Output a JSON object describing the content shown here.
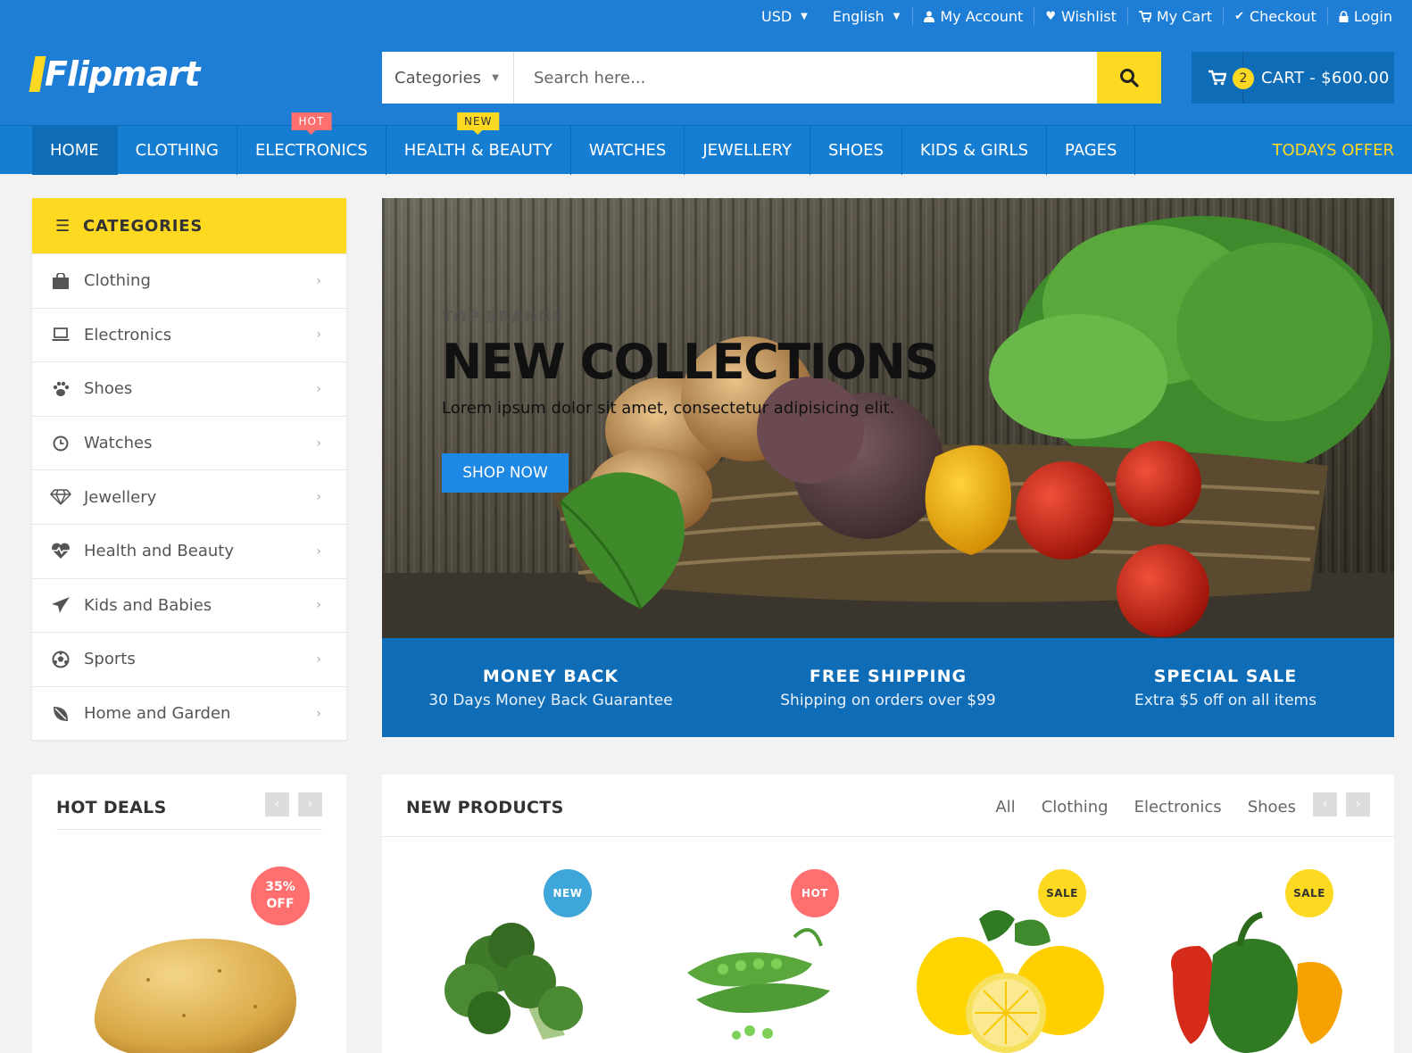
{
  "header": {
    "top_links": {
      "currency": "USD",
      "language": "English",
      "account": "My Account",
      "wishlist": "Wishlist",
      "cart": "My Cart",
      "checkout": "Checkout",
      "login": "Login"
    },
    "logo": "Flipmart",
    "search": {
      "category": "Categories",
      "placeholder": "Search here..."
    },
    "cart": {
      "count": "2",
      "label": "CART - $600.00"
    }
  },
  "nav": {
    "items": [
      {
        "label": "HOME"
      },
      {
        "label": "CLOTHING"
      },
      {
        "label": "ELECTRONICS",
        "tag": "HOT"
      },
      {
        "label": "HEALTH & BEAUTY",
        "tag": "NEW"
      },
      {
        "label": "WATCHES"
      },
      {
        "label": "JEWELLERY"
      },
      {
        "label": "SHOES"
      },
      {
        "label": "KIDS & GIRLS"
      },
      {
        "label": "PAGES"
      }
    ],
    "offer": "TODAYS OFFER"
  },
  "sidebar": {
    "title": "CATEGORIES",
    "items": [
      {
        "label": "Clothing"
      },
      {
        "label": "Electronics"
      },
      {
        "label": "Shoes"
      },
      {
        "label": "Watches"
      },
      {
        "label": "Jewellery"
      },
      {
        "label": "Health and Beauty"
      },
      {
        "label": "Kids and Babies"
      },
      {
        "label": "Sports"
      },
      {
        "label": "Home and Garden"
      }
    ]
  },
  "hero": {
    "subtitle": "TOP BRANDS",
    "title": "NEW COLLECTIONS",
    "description": "Lorem ipsum dolor sit amet, consectetur adipisicing elit.",
    "button": "SHOP NOW"
  },
  "info": [
    {
      "title": "MONEY BACK",
      "subtitle": "30 Days Money Back Guarantee"
    },
    {
      "title": "FREE SHIPPING",
      "subtitle": "Shipping on orders over $99"
    },
    {
      "title": "SPECIAL SALE",
      "subtitle": "Extra $5 off on all items"
    }
  ],
  "hot_deals": {
    "title": "HOT DEALS",
    "discount_value": "35%",
    "discount_label": "OFF"
  },
  "new_products": {
    "title": "NEW PRODUCTS",
    "filters": [
      "All",
      "Clothing",
      "Electronics",
      "Shoes"
    ],
    "badges": [
      "NEW",
      "HOT",
      "SALE",
      "SALE"
    ]
  },
  "colors": {
    "primary": "#1e7dd4",
    "dark_blue": "#0f6cb6",
    "accent_yellow": "#fdd922",
    "hot_red": "#ff6f6f",
    "new_blue": "#3ea6d8"
  }
}
